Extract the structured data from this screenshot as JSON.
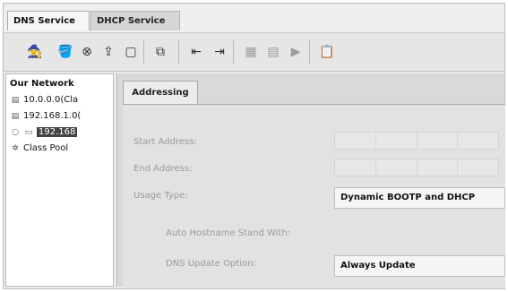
{
  "tabs": [
    {
      "label": "DNS Service"
    },
    {
      "label": "DHCP Service"
    }
  ],
  "toolbar": {
    "buttons": [
      {
        "icon": "wizard-icon"
      },
      {
        "icon": "paint-icon"
      },
      {
        "icon": "circle-x-icon"
      },
      {
        "icon": "import-icon"
      },
      {
        "icon": "window-icon"
      },
      {
        "icon": "copy-icon"
      },
      {
        "icon": "move-in-icon"
      },
      {
        "icon": "move-out-icon"
      },
      {
        "icon": "grid-icon"
      },
      {
        "icon": "grid2-icon"
      },
      {
        "icon": "play-icon"
      },
      {
        "icon": "report-icon"
      }
    ]
  },
  "tree": {
    "items": [
      {
        "label": "Our Network"
      },
      {
        "label": "10.0.0.0(Cla"
      },
      {
        "label": "192.168.1.0("
      },
      {
        "label": "192.168"
      },
      {
        "label": "Class Pool"
      }
    ]
  },
  "panel": {
    "subtab": "Addressing",
    "labels": {
      "start": "Start Address:",
      "end": "End Address:",
      "usage": "Usage Type:",
      "auto": "Auto Hostname Stand With:",
      "dns": "DNS Update Option:"
    },
    "usage_value": "Dynamic BOOTP and DHCP",
    "dns_value": "Always Update"
  }
}
